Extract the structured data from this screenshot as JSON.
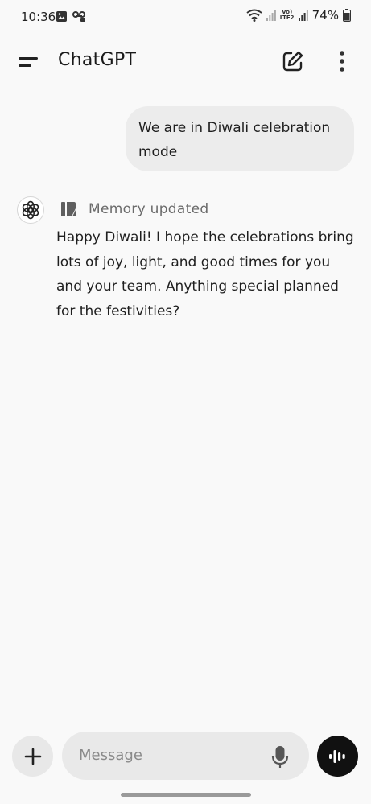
{
  "status_bar": {
    "time": "10:36",
    "left_icons": [
      "gallery-icon",
      "voicemail-icon"
    ],
    "right_icons": [
      "wifi-icon",
      "signal-icon",
      "lte-icon",
      "signal-icon",
      "battery-icon"
    ],
    "lte_label": "Vo) LTE2",
    "battery_percent": "74%"
  },
  "header": {
    "title": "ChatGPT",
    "menu_icon": "menu-icon",
    "new_chat_icon": "edit-icon",
    "more_icon": "more-vertical-icon"
  },
  "conversation": {
    "user_message": "We are in Diwali celebration mode",
    "assistant": {
      "avatar_icon": "openai-logo-icon",
      "memory_icon": "memory-icon",
      "memory_label": "Memory updated",
      "message": "Happy Diwali! I hope the celebrations bring lots of joy, light, and good times for you and your team. Anything special planned for the festivities?"
    }
  },
  "composer": {
    "placeholder": "Message",
    "plus_icon": "plus-icon",
    "mic_icon": "mic-icon",
    "voice_icon": "voice-mode-icon"
  },
  "colors": {
    "background": "#f9f9f9",
    "user_bubble": "#ececec",
    "composer_field": "#e9e9e9",
    "voice_button": "#111111"
  }
}
